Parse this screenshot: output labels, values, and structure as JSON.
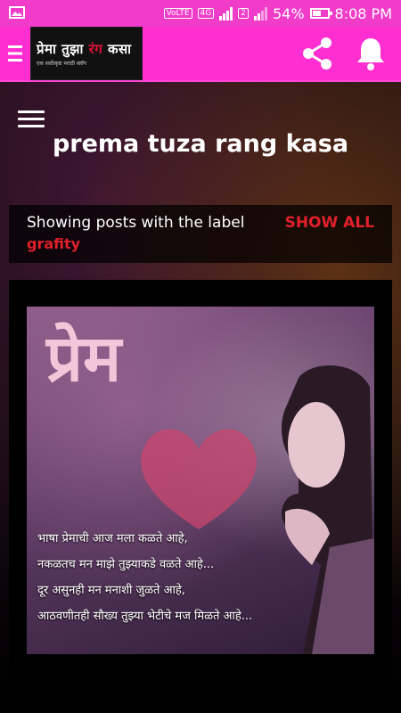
{
  "status": {
    "network_badge": "VoLTE",
    "network_type": "4G",
    "sim_slot": "2",
    "battery": "54%",
    "time": "8:08 PM"
  },
  "app_bar": {
    "logo_main_a": "प्रेमा तुझा",
    "logo_main_b": "रंग",
    "logo_main_c": "कसा",
    "logo_tagline": "एक सर्वोत्कृष्ट मराठी ब्लॉग"
  },
  "page": {
    "title": "prema tuza rang kasa"
  },
  "label_bar": {
    "text": "Showing posts with the label",
    "label": "grafity",
    "show_all": "SHOW ALL"
  },
  "post": {
    "image_title": "प्रेम",
    "poem_lines": [
      "भाषा प्रेमाची आज मला कळते आहे,",
      "नकळतच मन माझे तुझ्याकडे वळते आहे...",
      "दूर असुनही मन मनाशी जुळते आहे,",
      "आठवणीतही सौख्य तुझ्या भेटीचे मज मिळते आहे..."
    ]
  },
  "colors": {
    "status_bar": "#f03cc8",
    "app_bar": "#ff2ed0",
    "accent_red": "#e0202a"
  }
}
